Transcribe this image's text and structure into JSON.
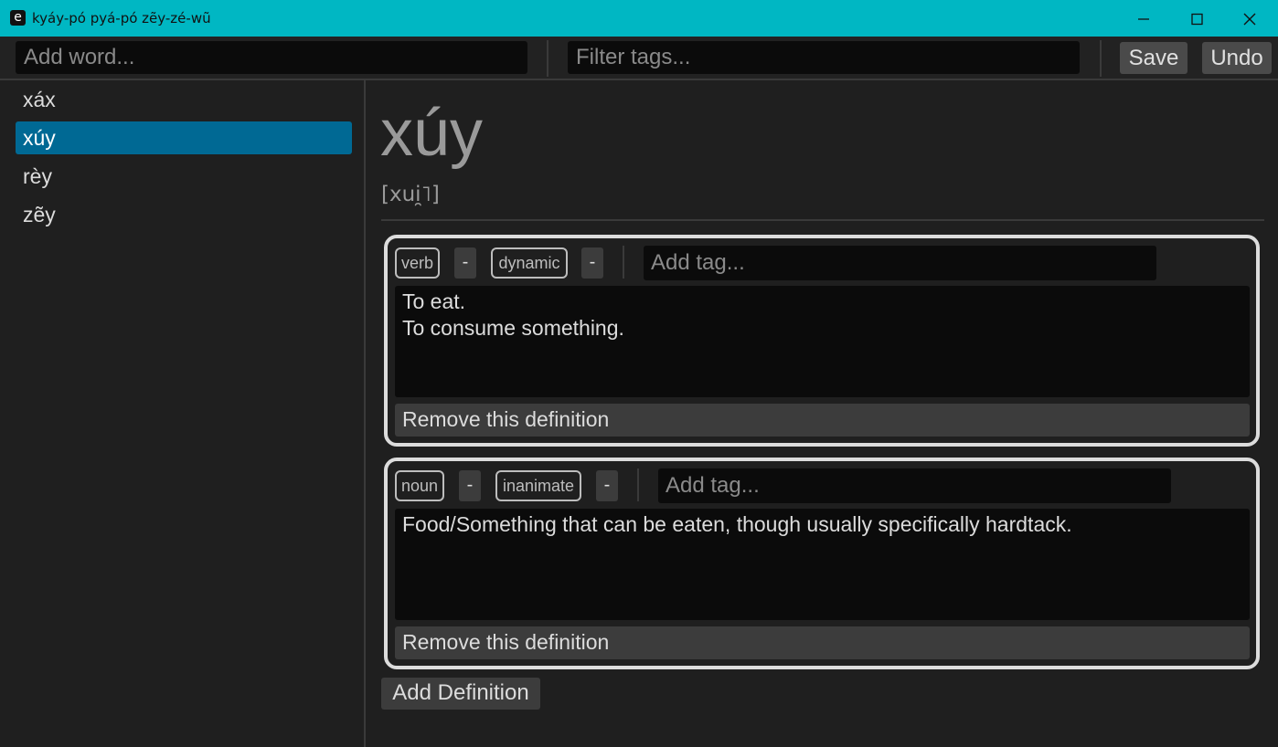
{
  "window": {
    "icon_letter": "e",
    "title": "kyáy-pó pyá-pó zẽy-zé-wũ",
    "accent": "#00b7c3"
  },
  "toolbar": {
    "add_word_placeholder": "Add word...",
    "filter_tags_placeholder": "Filter tags...",
    "save_label": "Save",
    "undo_label": "Undo"
  },
  "sidebar": {
    "words": [
      "xáx",
      "xúy",
      "rèy",
      "zẽy"
    ],
    "selected_index": 1,
    "selected_color": "#006994"
  },
  "entry": {
    "headword": "xúy",
    "ipa": "[xui̯˥]",
    "definitions": [
      {
        "tags": [
          "verb",
          "dynamic"
        ],
        "remove_tag_label": "-",
        "add_tag_placeholder": "Add tag...",
        "lines": [
          "To eat.",
          "To consume something."
        ],
        "remove_label": "Remove this definition"
      },
      {
        "tags": [
          "noun",
          "inanimate"
        ],
        "remove_tag_label": "-",
        "add_tag_placeholder": "Add tag...",
        "lines": [
          "Food/Something that can be eaten, though usually specifically hardtack."
        ],
        "remove_label": "Remove this definition"
      }
    ],
    "add_definition_label": "Add Definition"
  }
}
